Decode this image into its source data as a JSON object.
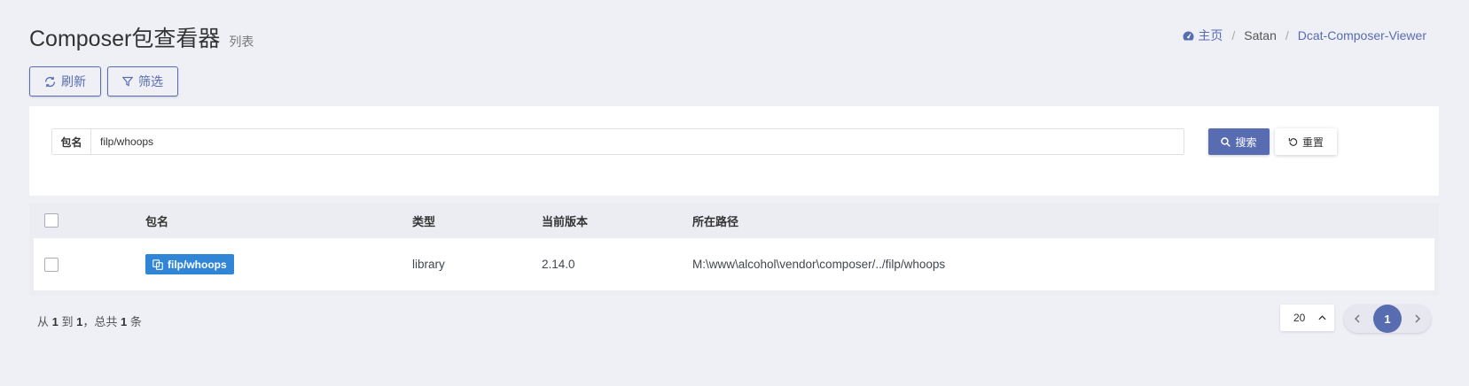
{
  "header": {
    "title": "Composer包查看器",
    "subtitle": "列表"
  },
  "breadcrumb": {
    "home": "主页",
    "items": [
      "Satan",
      "Dcat-Composer-Viewer"
    ]
  },
  "toolbar": {
    "refresh_label": "刷新",
    "filter_label": "筛选"
  },
  "filter": {
    "field_label": "包名",
    "field_value": "filp/whoops",
    "search_label": "搜索",
    "reset_label": "重置"
  },
  "table": {
    "headers": [
      "包名",
      "类型",
      "当前版本",
      "所在路径"
    ],
    "rows": [
      {
        "name": "filp/whoops",
        "type": "library",
        "version": "2.14.0",
        "path": "M:\\www\\alcohol\\vendor\\composer/../filp/whoops"
      }
    ]
  },
  "footer": {
    "from_label": "从",
    "from": "1",
    "to_label": "到",
    "to": "1",
    "total_label": "，总共",
    "total": "1",
    "unit_label": "条",
    "per_page": "20",
    "current_page": "1"
  },
  "colors": {
    "primary": "#586cb1",
    "badge": "#3085d6",
    "background": "#eff0f6"
  }
}
